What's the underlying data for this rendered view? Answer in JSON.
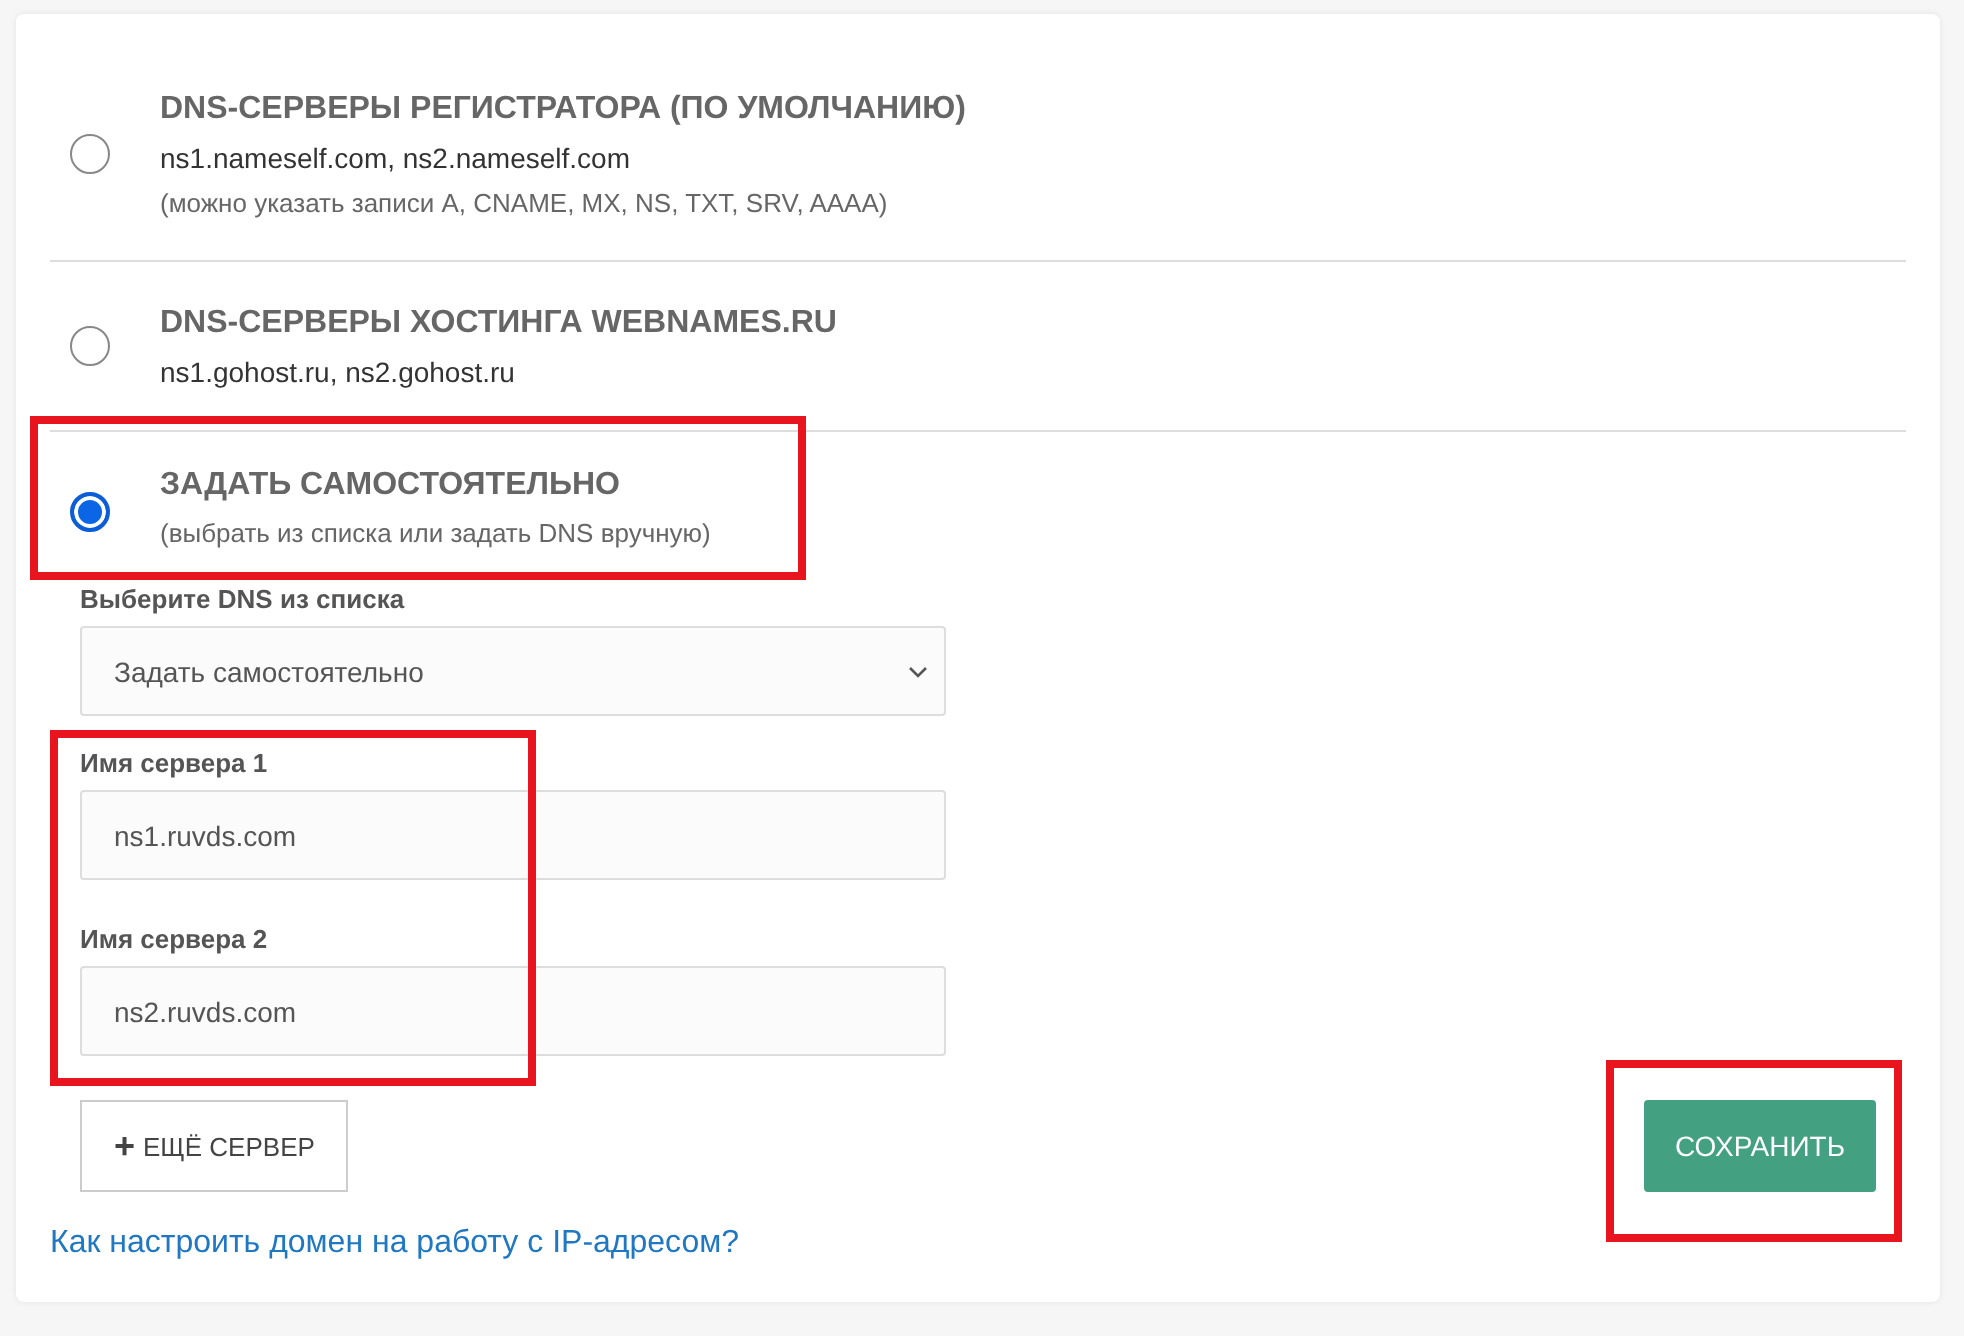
{
  "dns_options": [
    {
      "title": "DNS-СЕРВЕРЫ РЕГИСТРАТОРА (ПО УМОЛЧАНИЮ)",
      "servers": "ns1.nameself.com, ns2.nameself.com",
      "note": "(можно указать записи A, CNAME, MX, NS, TXT, SRV, AAAA)",
      "selected": false,
      "highlighted": false
    },
    {
      "title": "DNS-СЕРВЕРЫ ХОСТИНГА WEBNAMES.RU",
      "servers": "ns1.gohost.ru, ns2.gohost.ru",
      "selected": false,
      "highlighted": false
    },
    {
      "title": "ЗАДАТЬ САМОСТОЯТЕЛЬНО",
      "note": "(выбрать из списка или задать DNS вручную)",
      "selected": true,
      "highlighted": true
    }
  ],
  "dns_select": {
    "label": "Выберите DNS из списка",
    "value": "Задать самостоятельно"
  },
  "server_fields": {
    "highlighted": true,
    "items": [
      {
        "label": "Имя сервера 1",
        "value": "ns1.ruvds.com"
      },
      {
        "label": "Имя сервера 2",
        "value": "ns2.ruvds.com"
      }
    ]
  },
  "add_server_button": {
    "icon": "+",
    "label": "ЕЩЁ СЕРВЕР"
  },
  "save_button": {
    "label": "СОХРАНИТЬ",
    "highlighted": true
  },
  "help_link": "Как настроить домен на работу с IP-адресом?"
}
